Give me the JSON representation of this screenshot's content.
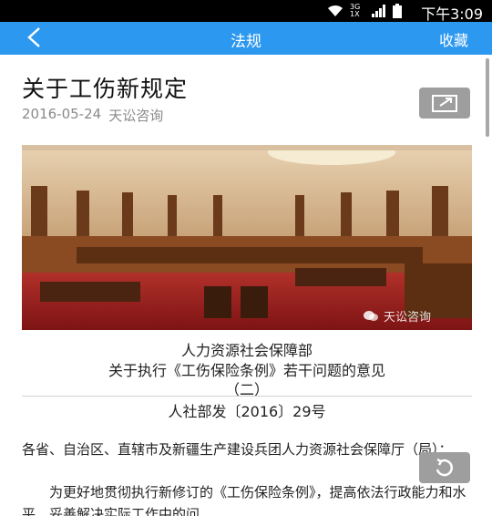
{
  "statusbar": {
    "time": "下午3:09",
    "network": "3G 1X"
  },
  "navbar": {
    "title": "法规",
    "favorite": "收藏"
  },
  "article": {
    "title": "关于工伤新规定",
    "date": "2016-05-24",
    "source": "天讼咨询",
    "watermark": "天讼咨询",
    "heading1": "人力资源社会保障部",
    "heading2": "关于执行《工伤保险条例》若干问题的意见",
    "heading3": "（二）",
    "docno": "人社部发〔2016〕29号",
    "para1": "各省、自治区、直辖市及新疆生产建设兵团人力资源社会保障厅（局）：",
    "para2": "为更好地贯彻执行新修订的《工伤保险条例》，提高依法行政能力和水平，妥善解决实际工作中的问"
  },
  "icons": {
    "back": "back-arrow-icon",
    "share": "share-icon",
    "refresh": "refresh-icon",
    "wifi": "wifi-icon",
    "signal": "signal-icon",
    "battery": "battery-icon"
  },
  "colors": {
    "navbar": "#2d98ef",
    "statusbar": "#000000",
    "button": "#9e9e9e"
  }
}
